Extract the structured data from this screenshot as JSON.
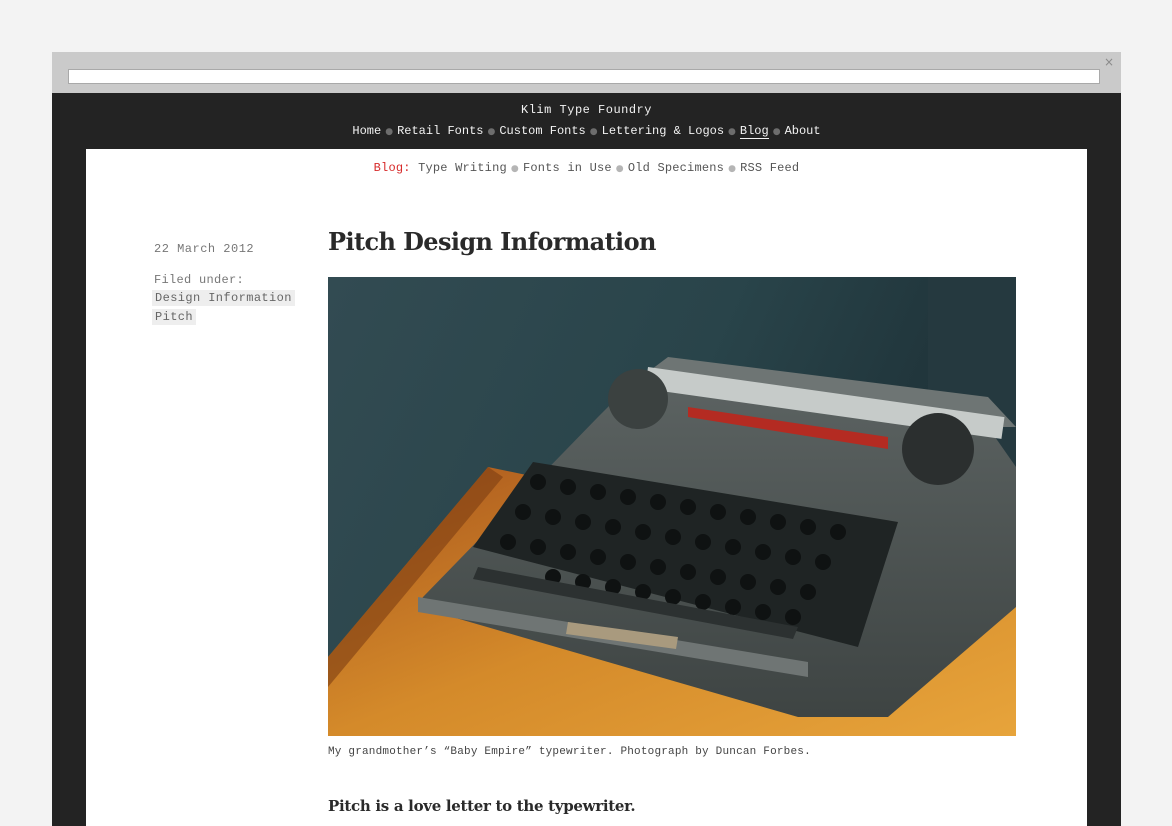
{
  "site": {
    "title": "Klim Type Foundry"
  },
  "nav": {
    "items": [
      {
        "label": "Home",
        "active": false
      },
      {
        "label": "Retail Fonts",
        "active": false
      },
      {
        "label": "Custom Fonts",
        "active": false
      },
      {
        "label": "Lettering & Logos",
        "active": false
      },
      {
        "label": "Blog",
        "active": true
      },
      {
        "label": "About",
        "active": false
      }
    ]
  },
  "subnav": {
    "label": "Blog:",
    "items": [
      {
        "label": "Type Writing"
      },
      {
        "label": "Fonts in Use"
      },
      {
        "label": "Old Specimens"
      },
      {
        "label": "RSS Feed"
      }
    ]
  },
  "post": {
    "date": "22 March 2012",
    "filed_label": "Filed under:",
    "tags": [
      "Design Information",
      "Pitch"
    ],
    "title": "Pitch Design Information",
    "caption": "My grandmother’s “Baby Empire” typewriter. Photograph by Duncan Forbes.",
    "lede": "Pitch is a love letter to the typewriter."
  },
  "icons": {
    "close": "close-icon",
    "separator": "bullet-separator"
  },
  "colors": {
    "accent": "#d72a2a",
    "header_bg": "#232323",
    "chrome": "#cacaca"
  }
}
